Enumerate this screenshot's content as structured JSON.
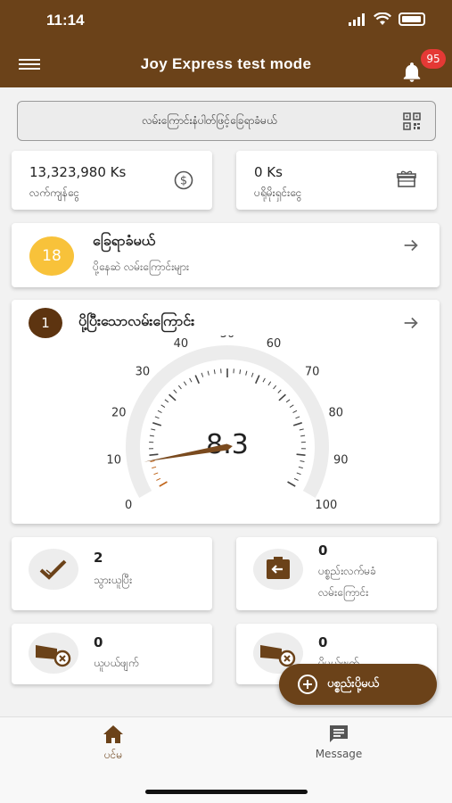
{
  "status_bar": {
    "time": "11:14"
  },
  "app_bar": {
    "title": "Joy Express test mode",
    "notification_count": "95"
  },
  "search": {
    "placeholder": "လမ်းကြောင်းနံပါတ်ဖြင့်ခြေရာခံမယ်"
  },
  "balances": [
    {
      "amount": "13,323,980 Ks",
      "label": "လက်ကျန်ငွေ",
      "icon": "dollar-icon"
    },
    {
      "amount": "0 Ks",
      "label": "ပရိုမိုးရှင်းငွေ",
      "icon": "gift-icon"
    }
  ],
  "pickup": {
    "count": "18",
    "title": "ခြေရာခံမယ်",
    "subtitle": "ပို့နေဆဲ လမ်းကြောင်းများ"
  },
  "delivered": {
    "count": "1",
    "title": "ပို့ပြီးသောလမ်းကြောင်း"
  },
  "gauge": {
    "value": 8.3,
    "value_label": "8.3",
    "min": 0,
    "max": 100,
    "tick_labels": [
      "0",
      "10",
      "20",
      "30",
      "40",
      "50",
      "60",
      "70",
      "80",
      "90",
      "100"
    ]
  },
  "stats": [
    {
      "count": "2",
      "label_lines": [
        "သွားယူပြီး"
      ],
      "icon": "check-icon"
    },
    {
      "count": "0",
      "label_lines": [
        "ပစ္စည်းလက်မခံ",
        "လမ်းကြောင်း"
      ],
      "icon": "return-box-icon"
    },
    {
      "count": "0",
      "label_lines": [
        "ယူပယ်ဖျက်"
      ],
      "icon": "cancel-truck-icon"
    },
    {
      "count": "0",
      "label_lines": [
        "ပို့ပယ်ဖျက်"
      ],
      "icon": "cancel-truck-icon"
    }
  ],
  "fab": {
    "label": "ပစ္စည်းပို့မယ်"
  },
  "bottom_nav": [
    {
      "label": "ပင်မ",
      "icon": "home-icon",
      "active": true
    },
    {
      "label": "Message",
      "icon": "message-icon",
      "active": false
    }
  ],
  "colors": {
    "brand_brown": "#6b4219",
    "badge_red": "#e53935",
    "pickup_yellow": "#f8c23a",
    "gauge_needle": "#7a4a1e"
  }
}
